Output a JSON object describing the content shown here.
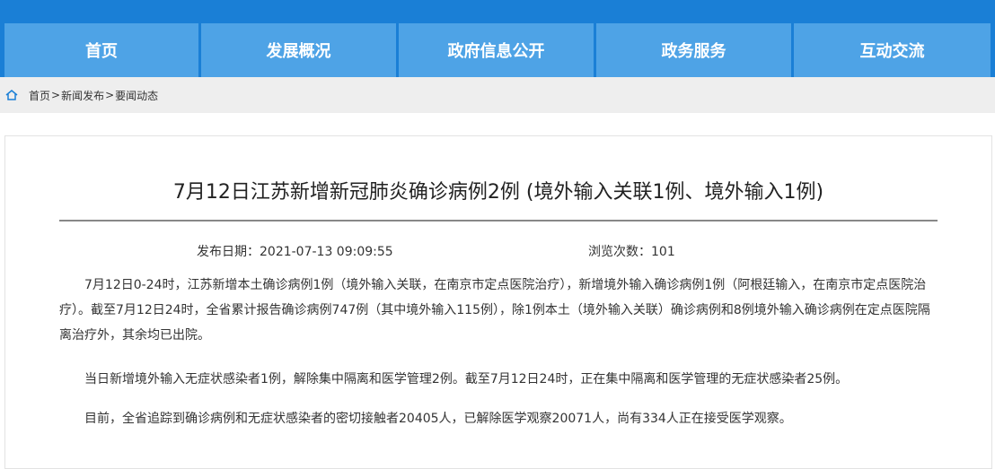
{
  "nav": {
    "items": [
      {
        "label": "首页"
      },
      {
        "label": "发展概况"
      },
      {
        "label": "政府信息公开"
      },
      {
        "label": "政务服务"
      },
      {
        "label": "互动交流"
      }
    ]
  },
  "breadcrumb": {
    "icon": "home-icon",
    "items": [
      "首页",
      "新闻发布",
      "要闻动态"
    ],
    "separator": ">"
  },
  "article": {
    "title": "7月12日江苏新增新冠肺炎确诊病例2例 (境外输入关联1例、境外输入1例)",
    "publish_label": "发布日期：",
    "publish_date": "2021-07-13 09:09:55",
    "views_label": "浏览次数：",
    "views": "101",
    "paragraphs": [
      "7月12日0-24时，江苏新增本土确诊病例1例（境外输入关联，在南京市定点医院治疗），新增境外输入确诊病例1例（阿根廷输入，在南京市定点医院治疗）。截至7月12日24时，全省累计报告确诊病例747例（其中境外输入115例），除1例本土（境外输入关联）确诊病例和8例境外输入确诊病例在定点医院隔离治疗外，其余均已出院。",
      "当日新增境外输入无症状感染者1例，解除集中隔离和医学管理2例。截至7月12日24时，正在集中隔离和医学管理的无症状感染者25例。",
      "目前，全省追踪到确诊病例和无症状感染者的密切接触者20405人，已解除医学观察20071人，尚有334人正在接受医学观察。"
    ]
  },
  "colors": {
    "nav_bg": "#1a7fd6",
    "nav_item_bg": "#4ea3e6",
    "breadcrumb_bg": "#eeeeee"
  }
}
